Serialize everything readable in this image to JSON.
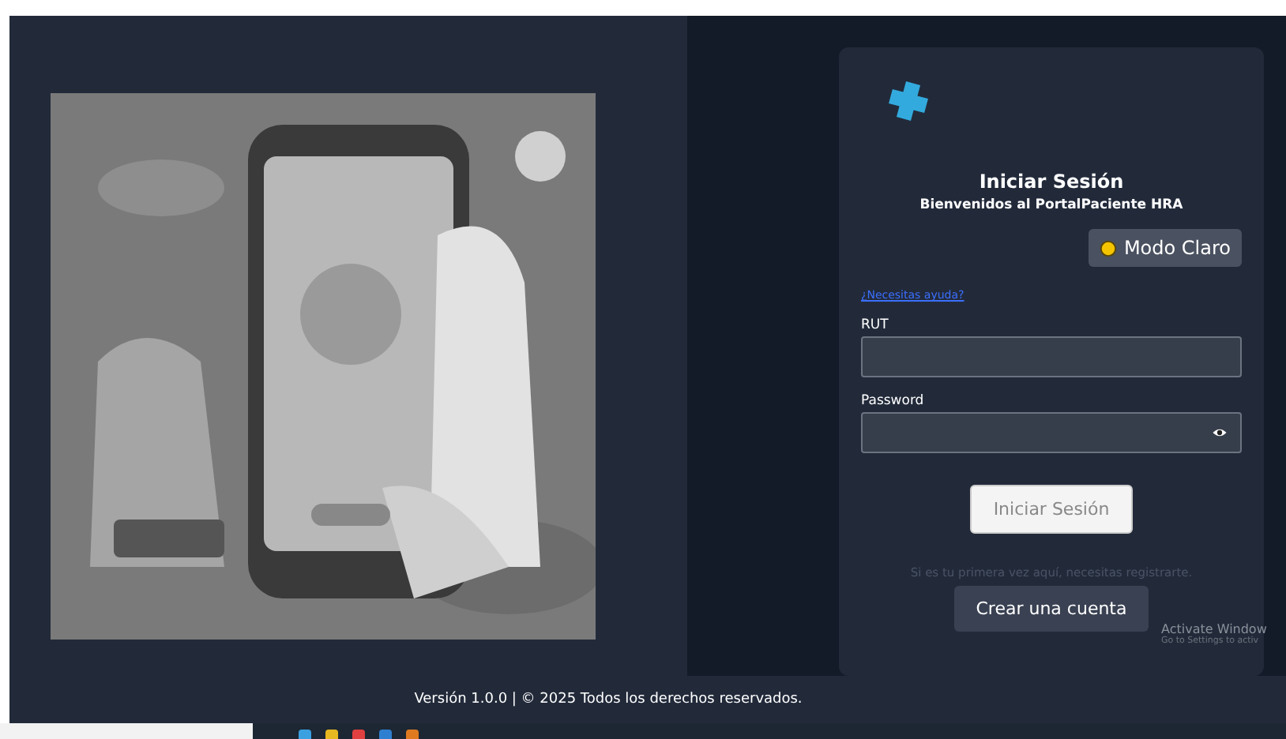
{
  "login": {
    "title": "Iniciar Sesión",
    "subtitle": "Bienvenidos al PortalPaciente HRA",
    "theme_button": "Modo Claro",
    "help_link": "¿Necesitas ayuda?",
    "fields": [
      {
        "label": "RUT",
        "kind": "text"
      },
      {
        "label": "Password",
        "kind": "password"
      }
    ],
    "submit": "Iniciar Sesión",
    "register_hint": "Si es tu primera vez aquí, necesitas registrarte.",
    "register_button": "Crear una cuenta"
  },
  "footer": "Versión 1.0.0 | © 2025 Todos los derechos reservados.",
  "activation": {
    "title": "Activate Window",
    "hint": "Go to Settings to activ"
  }
}
